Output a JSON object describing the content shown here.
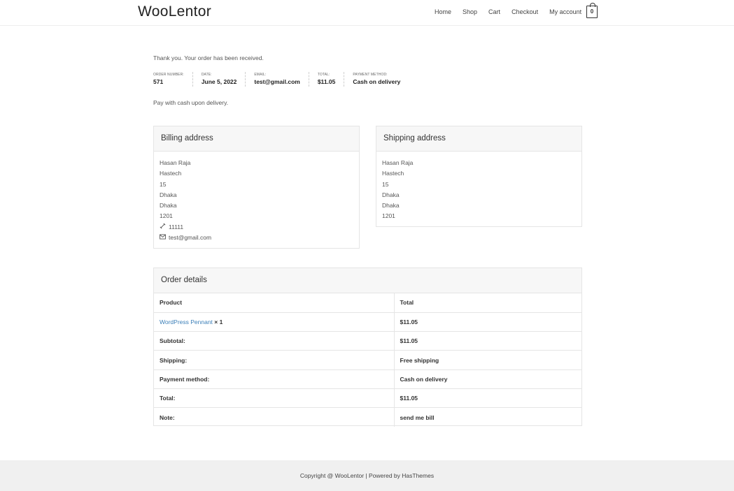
{
  "header": {
    "logo": "WooLentor",
    "nav": [
      "Home",
      "Shop",
      "Cart",
      "Checkout",
      "My account"
    ],
    "cart_count": "0"
  },
  "thankyou": "Thank you. Your order has been received.",
  "overview": [
    {
      "label": "Order number:",
      "value": "571"
    },
    {
      "label": "Date:",
      "value": "June 5, 2022"
    },
    {
      "label": "Email:",
      "value": "test@gmail.com"
    },
    {
      "label": "Total:",
      "value": "$11.05"
    },
    {
      "label": "Payment method:",
      "value": "Cash on delivery"
    }
  ],
  "pay_note": "Pay with cash upon delivery.",
  "billing": {
    "title": "Billing address",
    "lines": [
      "Hasan Raja",
      "Hastech",
      "15",
      "Dhaka",
      "Dhaka",
      "1201"
    ],
    "phone": "11111",
    "email": "test@gmail.com",
    "phone_icon": "phone-icon",
    "email_icon": "envelope-icon"
  },
  "shipping": {
    "title": "Shipping address",
    "lines": [
      "Hasan Raja",
      "Hastech",
      "15",
      "Dhaka",
      "Dhaka",
      "1201"
    ]
  },
  "order": {
    "title": "Order details",
    "head_product": "Product",
    "head_total": "Total",
    "item_name": "WordPress Pennant",
    "item_qty": "× 1",
    "item_total": "$11.05",
    "rows": [
      {
        "label": "Subtotal:",
        "value": "$11.05"
      },
      {
        "label": "Shipping:",
        "value": "Free shipping"
      },
      {
        "label": "Payment method:",
        "value": "Cash on delivery"
      },
      {
        "label": "Total:",
        "value": "$11.05"
      },
      {
        "label": "Note:",
        "value": "send me bill"
      }
    ]
  },
  "footer": "Copyright @ WooLentor | Powered by HasThemes"
}
